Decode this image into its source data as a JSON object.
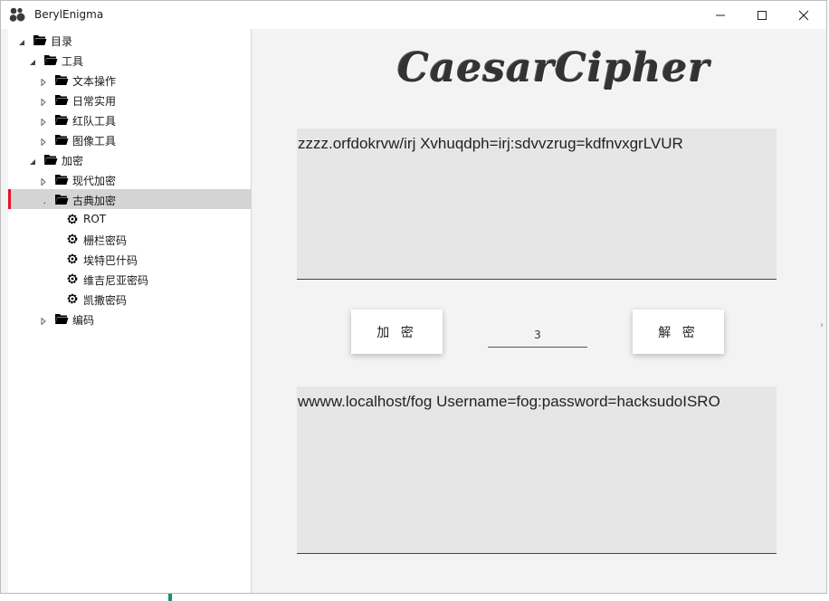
{
  "window": {
    "title": "BerylEnigma"
  },
  "tree": [
    {
      "label": "目录",
      "level": 0,
      "expanded": true,
      "icon": "folder-open-icon",
      "arrow": "expanded"
    },
    {
      "label": "工具",
      "level": 1,
      "expanded": true,
      "icon": "folder-open-icon",
      "arrow": "expanded"
    },
    {
      "label": "文本操作",
      "level": 2,
      "icon": "folder-open-icon",
      "arrow": "collapsed"
    },
    {
      "label": "日常实用",
      "level": 2,
      "icon": "folder-open-icon",
      "arrow": "collapsed"
    },
    {
      "label": "红队工具",
      "level": 2,
      "icon": "folder-open-icon",
      "arrow": "collapsed"
    },
    {
      "label": "图像工具",
      "level": 2,
      "icon": "folder-open-icon",
      "arrow": "collapsed"
    },
    {
      "label": "加密",
      "level": 1,
      "expanded": true,
      "icon": "folder-open-icon",
      "arrow": "expanded"
    },
    {
      "label": "现代加密",
      "level": 2,
      "icon": "folder-open-icon",
      "arrow": "collapsed"
    },
    {
      "label": "古典加密",
      "level": 2,
      "icon": "folder-open-icon",
      "arrow": "expanded-small",
      "selected": true
    },
    {
      "label": "ROT",
      "level": 3,
      "icon": "gear-icon"
    },
    {
      "label": "栅栏密码",
      "level": 3,
      "icon": "gear-icon"
    },
    {
      "label": "埃特巴什码",
      "level": 3,
      "icon": "gear-icon"
    },
    {
      "label": "维吉尼亚密码",
      "level": 3,
      "icon": "gear-icon"
    },
    {
      "label": "凯撒密码",
      "level": 3,
      "icon": "gear-icon"
    },
    {
      "label": "编码",
      "level": 2,
      "icon": "folder-open-icon",
      "arrow": "collapsed"
    }
  ],
  "main": {
    "title": "CaesarCipher",
    "ciphertext": "zzzz.orfdokrvw/irj Xvhuqdph=irj:sdvvzrug=kdfnvxgrLVUR",
    "encrypt_label": "加 密",
    "decrypt_label": "解 密",
    "shift_value": "3",
    "plaintext": "wwww.localhost/fog Username=fog:password=hacksudoISRO"
  },
  "colors": {
    "selection_marker": "#e81123",
    "selection_bg": "#d4d4d4"
  }
}
